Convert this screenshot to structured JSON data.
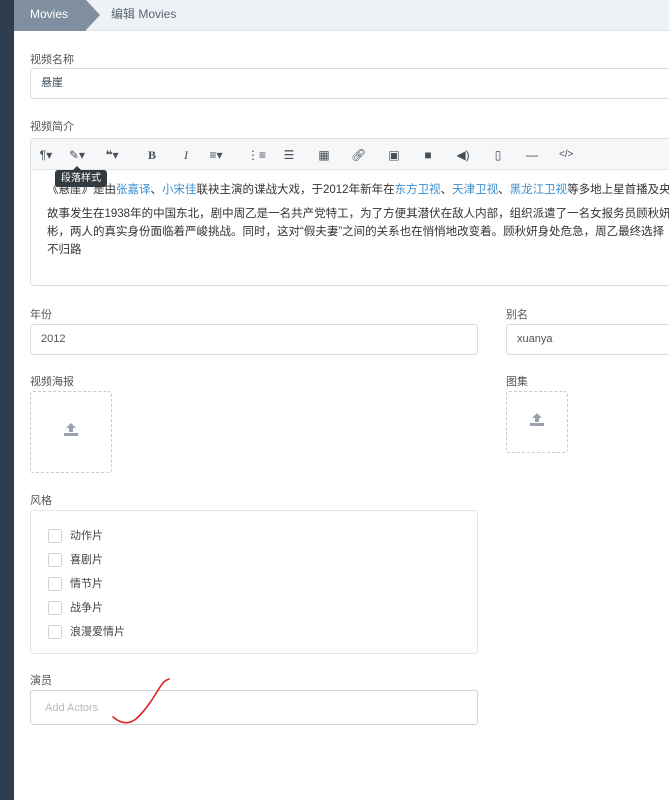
{
  "breadcrumb": {
    "first": "Movies",
    "second": "编辑 Movies"
  },
  "form": {
    "title_label": "视频名称",
    "title_value": "悬崖",
    "intro_label": "视频简介",
    "tooltip": "段落样式",
    "intro_p1": {
      "t1": "《悬崖》是由",
      "l1": "张嘉译",
      "t2": "、",
      "l2": "小宋佳",
      "t3": "联袂主演的谍战大戏，于2012年新年在",
      "l3": "东方卫视",
      "t4": "、",
      "l4": "天津卫视",
      "t5": "、",
      "l5": "黑龙江卫视",
      "t6": "等多地上星首播及央"
    },
    "intro_p2_line1": "故事发生在1938年的中国东北，剧中周乙是一名共产党特工，为了方便其潜伏在敌人内部，组织派遣了一名女报务员顾秋妍",
    "intro_p2_line2": "彬，两人的真实身份面临着严峻挑战。同时，这对“假夫妻”之间的关系也在悄悄地改变着。顾秋妍身处危急，周乙最终选择",
    "intro_p2_line3": "不归路",
    "year_label": "年份",
    "year_value": "2012",
    "alias_label": "别名",
    "alias_value": "xuanya",
    "poster_label": "视频海报",
    "gallery_label": "图集",
    "genre_label": "风格",
    "genres": [
      "动作片",
      "喜剧片",
      "情节片",
      "战争片",
      "浪漫爱情片"
    ],
    "actors_label": "演员",
    "actors_placeholder": "Add Actors"
  },
  "colors": {
    "link": "#3b8fd0",
    "sidebar": "#2f3e4f",
    "annotation": "#e02020"
  }
}
